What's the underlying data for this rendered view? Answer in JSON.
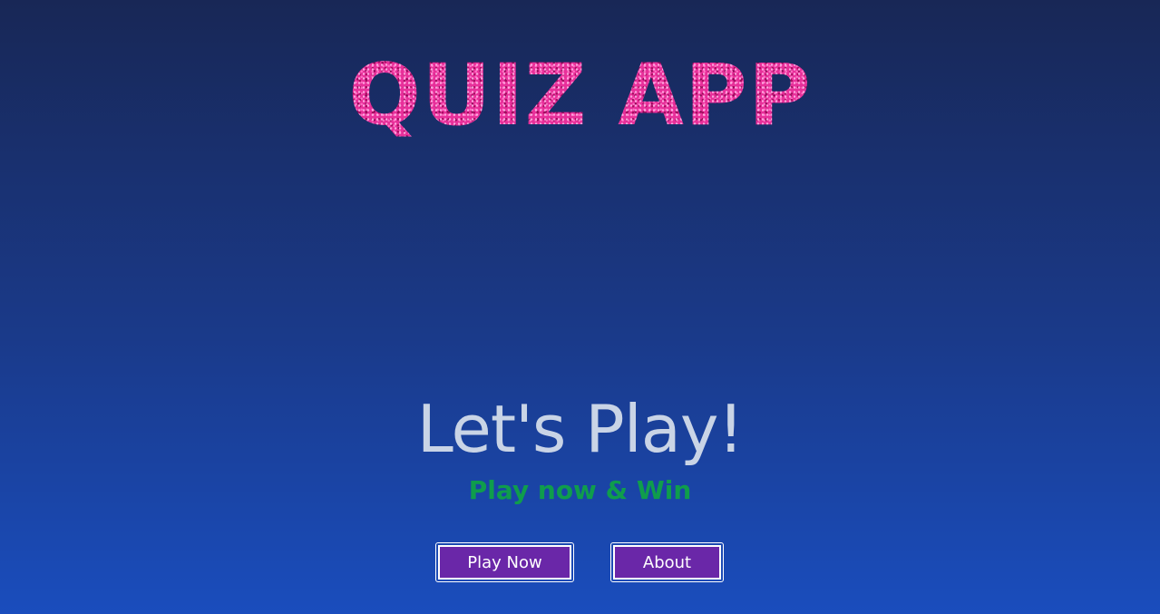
{
  "header": {
    "title": "QUIZ APP"
  },
  "hero": {
    "headline": "Let's Play!",
    "subtitle": "Play now & Win"
  },
  "actions": {
    "play_label": "Play Now",
    "about_label": "About"
  },
  "colors": {
    "background_top": "#182756",
    "background_bottom": "#1a4dbd",
    "title_pink": "#e8309a",
    "headline": "#c9d4e6",
    "subtitle_green": "#0f9d4c",
    "button_purple": "#6a27a8"
  }
}
